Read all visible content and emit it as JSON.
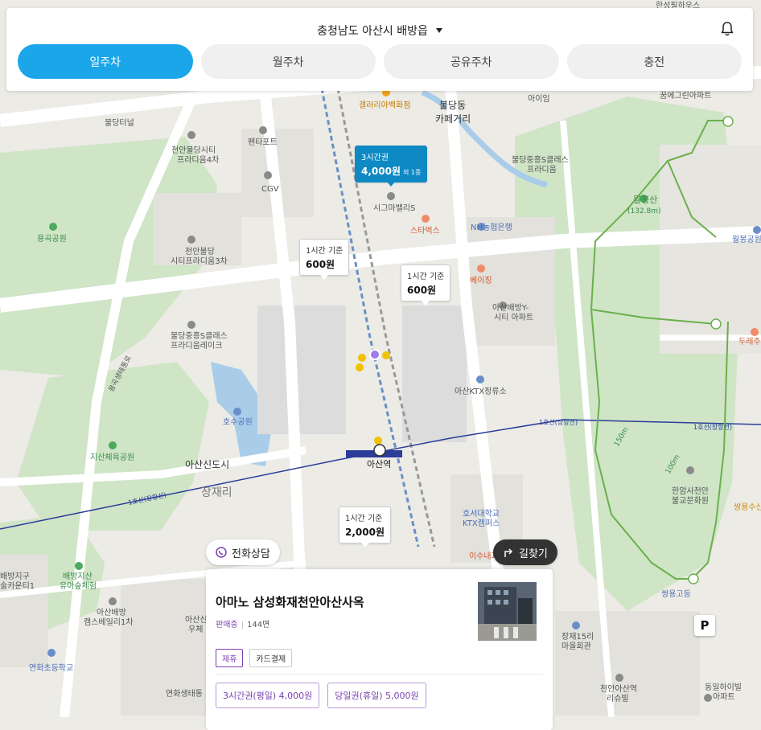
{
  "header": {
    "location": "충청남도 아산시 배방읍",
    "tabs": [
      {
        "label": "일주차",
        "active": true
      },
      {
        "label": "월주차",
        "active": false
      },
      {
        "label": "공유주차",
        "active": false
      },
      {
        "label": "충전",
        "active": false
      }
    ]
  },
  "map_labels": {
    "galleria": "갤러리아백화점",
    "buldang_cafe": "불당동\n카페거리",
    "buldang_dong": "불당동",
    "cafe_street": "카페거리",
    "buldang_tunnel": "불당터널",
    "pentaport": "펜타포트",
    "cheonan_buldang_city": "천안불당시티\n프라디움4차",
    "cheonan_buldang_city_l1": "천안불당시티",
    "cheonan_buldang_city_l2": "프라디움4차",
    "cgv": "CGV",
    "sigma_valley": "시그마밸리S",
    "starbucks": "스타벅스",
    "nh_bank": "NH농협은행",
    "yonggok_park": "용곡공원",
    "cheonan_buldang_city3_l1": "천안불당",
    "cheonan_buldang_city3_l2": "시티프라디움3차",
    "baejing": "베이징",
    "asan_baebang_l1": "아산배방Y-",
    "asan_baebang_l2": "시티 아파트",
    "buldang_jungheung_l1": "불당중흥S클래스",
    "buldang_jungheung_l2": "프라디움레이크",
    "buldang_jungheung_cl_l1": "불당중흥S클래스",
    "buldang_jungheung_cl_l2": "프라디움",
    "ktx_stop": "아산KTX정류소",
    "hosu_park": "호수공원",
    "jisan_park": "지산체육공원",
    "asan_newcity": "아산신도시",
    "jangjae": "장재리",
    "asan_station": "아산역",
    "line1_left": "1호선(장항선)",
    "line1_mid": "1호선(장항선)",
    "line1_right": "1호선(장항선)",
    "hoseo_ktx_l1": "호서대학교",
    "hoseo_ktx_l2": "KTX캠퍼스",
    "isu": "이수내과",
    "wolbongsan": "월봉산",
    "wolbongsan_h": "(132.8m)",
    "wolbong_park": "월봉공원",
    "dure": "두레주",
    "trail_150": "150m",
    "trail_100": "100m",
    "hanam_temple_l1": "한암사천안",
    "hanam_temple_l2": "불교문화원",
    "ssangyong_su": "쌍용수산",
    "ssangyong_high": "쌍용고등",
    "jangjae15_l1": "장재15리",
    "jangjae15_l2": "마을회관",
    "baebang_jigu_l1": "배방지구",
    "baebang_jigu_l2": "술카운티1",
    "baebang_kinder_l1": "배방지산",
    "baebang_kinder_l2": "유아숲체험",
    "asan_baebang_camp_l1": "아산배방",
    "asan_baebang_camp_l2": "캠스베일리1차",
    "asansin_l1": "아산신",
    "asansin_l2": "우체",
    "yeonhwa_school": "연화초등학교",
    "yeonhwa_eco": "연화생태통",
    "cheonan_asan_l1": "천안아산역",
    "cheonan_asan_l2": "리슈빌",
    "dongil_l1": "동일하이빌",
    "dongil_l2": "아파트",
    "aoyim": "아이임",
    "kkum_egg": "꿈에그린아파트",
    "hanseong": "한성필하우스",
    "yongguk": "용곡생태통로"
  },
  "price_markers": [
    {
      "label": "3시간권",
      "price": "4,000원",
      "extra": "외 1종",
      "selected": true
    },
    {
      "label": "1시간 기준",
      "price": "600원"
    },
    {
      "label": "1시간 기준",
      "price": "600원"
    },
    {
      "label": "1시간 기준",
      "price": "2,000원"
    }
  ],
  "actions": {
    "call": "전화상담",
    "directions": "길찾기"
  },
  "card": {
    "title": "아마노 삼성화재천안아산사옥",
    "status": "판매중",
    "spaces": "144면",
    "tags": [
      "제휴",
      "카드결제"
    ],
    "tickets": [
      "3시간권(평일) 4,000원",
      "당일권(휴일) 5,000원"
    ]
  },
  "parking_badge": "P"
}
